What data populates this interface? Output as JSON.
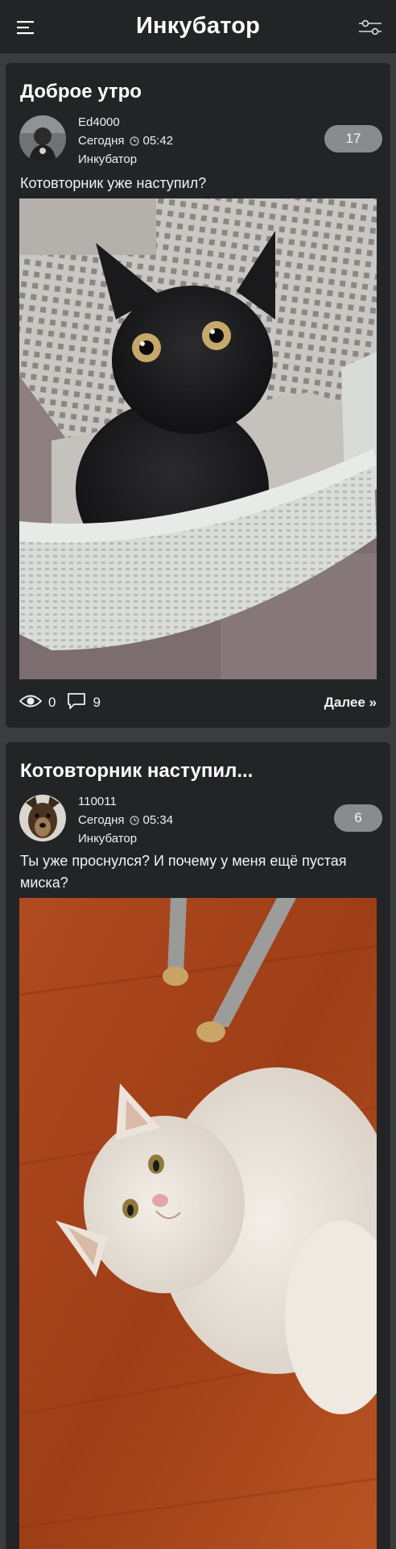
{
  "app": {
    "title": "Инкубатор",
    "menu_icon": "hamburger-menu-icon",
    "filter_icon": "filter-sliders-icon"
  },
  "colors": {
    "background": "#3b3c3e",
    "card": "#232426",
    "badge": "#8a8b8d",
    "text": "#ffffff"
  },
  "posts": [
    {
      "title": "Доброе утро",
      "author": "Ed4000",
      "date": "Сегодня",
      "time": "05:42",
      "community": "Инкубатор",
      "rating": "17",
      "text": "Котовторник уже наступил?",
      "image_icon": "black-kitten-in-basket-photo",
      "views": "0",
      "comments": "9",
      "more_label": "Далее »"
    },
    {
      "title": "Котовторник наступил...",
      "author": "110011",
      "date": "Сегодня",
      "time": "05:34",
      "community": "Инкубатор",
      "rating": "6",
      "text": "Ты уже проснулся? И почему у меня ещё пустая миска?",
      "image_icon": "white-cat-on-floor-photo"
    }
  ]
}
